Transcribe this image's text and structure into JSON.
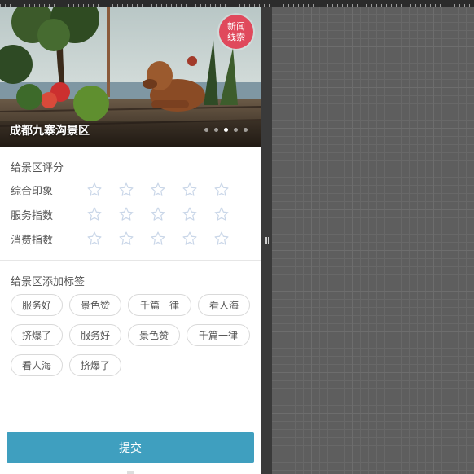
{
  "hero": {
    "badge_line1": "新闻",
    "badge_line2": "线索",
    "title": "成都九寨沟景区",
    "slide_count": 5,
    "active_slide": 3
  },
  "rating": {
    "section_title": "给景区评分",
    "rows": [
      {
        "label": "综合印象",
        "stars_selected": 0,
        "stars_total": 5
      },
      {
        "label": "服务指数",
        "stars_selected": 0,
        "stars_total": 5
      },
      {
        "label": "消费指数",
        "stars_selected": 0,
        "stars_total": 5
      }
    ]
  },
  "tags": {
    "section_title": "给景区添加标签",
    "rows": [
      [
        "服务好",
        "景色赞",
        "千篇一律",
        "看人海"
      ],
      [
        "挤爆了",
        "服务好",
        "景色赞",
        "千篇一律"
      ],
      [
        "看人海",
        "挤爆了"
      ]
    ]
  },
  "submit_label": "提交",
  "colors": {
    "accent": "#3f9fbf",
    "badge": "#e0495c",
    "star_outline": "#c9d6e8"
  }
}
